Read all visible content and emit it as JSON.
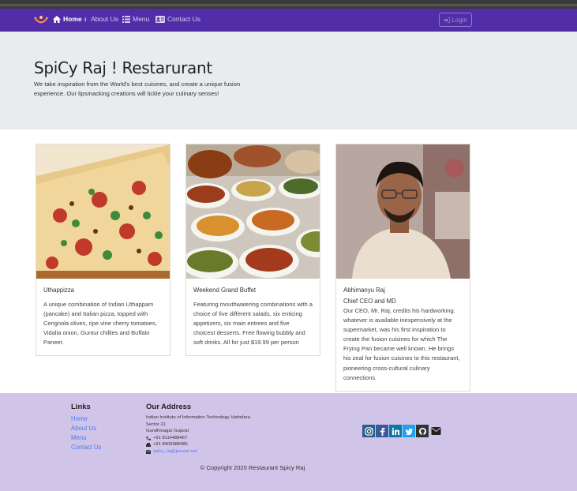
{
  "nav": {
    "items": [
      {
        "label": "Home",
        "icon": "home-icon",
        "active": true
      },
      {
        "label": "About Us",
        "icon": "info-icon",
        "active": false
      },
      {
        "label": "Menu",
        "icon": "list-icon",
        "active": false
      },
      {
        "label": "Contact Us",
        "icon": "address-card-icon",
        "active": false
      }
    ],
    "login_label": "Login"
  },
  "jumbotron": {
    "title": "SpiCy Raj ! Restarurant",
    "description": "We take inspiration from the World's best cuisines, and create a unique fusion experience. Our lipsmacking creations will tickle your culinary senses!"
  },
  "cards": [
    {
      "title": "Uthappizza",
      "subtitle": "",
      "text": "A unique combination of Indian Uthappam (pancake) and Italian pizza, topped with Cerignola olives, ripe vine cherry tomatoes, Vidalia onion, Guntur chillies and Buffalo Paneer."
    },
    {
      "title": "Weekend Grand Buffet",
      "subtitle": "",
      "text": "Featuring mouthwatering combinations with a choice of five different salads, six enticing appetizers, six main entrees and five choicest desserts. Free flowing bubbly and soft drinks. All for just $19.99 per person"
    },
    {
      "title": "Abhimanyu Raj",
      "subtitle": "Chief CEO and MD",
      "text": "Our CEO, Mr. Raj, credits his hardworking. whatever is available inexpensively at the supermarket, was his first inspiration to create the fusion cuisines for which The Frying Pan became well known. He brings his zeal for fusion cuisines to this restaurant, pioneering cross-cultural culinary connections."
    }
  ],
  "footer": {
    "links_heading": "Links",
    "links": [
      "Home",
      "About Us",
      "Menu",
      "Contact Us"
    ],
    "address_heading": "Our Address",
    "address_lines": [
      "Indian Institute of Information Technology Vadodara",
      "Sector 21",
      "Gandhinagar Gujarat"
    ],
    "phone": "+91 8114488467",
    "fax": "+91 8406988486",
    "email": "spicy_raj@jeevan.net",
    "copyright": "© Copyright 2020 Restaurant Spicy Raj"
  },
  "colors": {
    "navbar": "#512da8",
    "jumbotron": "#e9ecef",
    "footer": "#d1c4e9",
    "link": "#4a7cf0"
  }
}
